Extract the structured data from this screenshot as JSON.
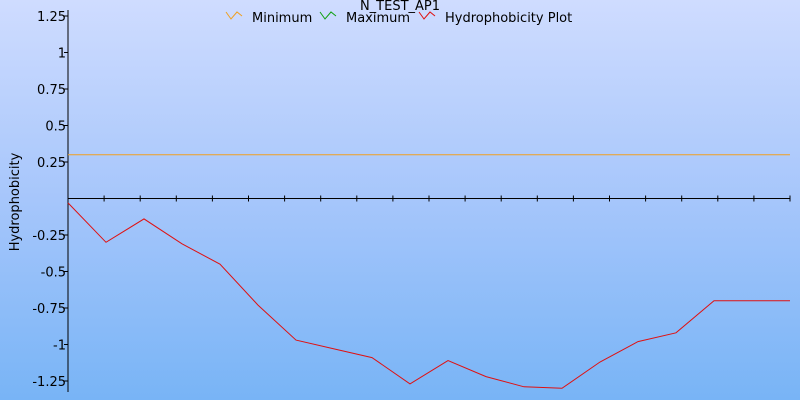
{
  "chart_data": {
    "type": "line",
    "title": "N_TEST_AP1",
    "xlabel": "",
    "ylabel": "Hydrophobicity",
    "ylim": [
      -1.3,
      1.35
    ],
    "y_ticks": [
      1.25,
      1,
      0.75,
      0.5,
      0.25,
      -0.25,
      -0.5,
      -0.75,
      -1,
      -1.25
    ],
    "y_tick_labels": [
      "1.25",
      "1",
      "0.75",
      "0.5",
      "0.25",
      "-0.25",
      "-0.5",
      "-0.75",
      "-1",
      "-1.25"
    ],
    "x": [
      1,
      2,
      3,
      4,
      5,
      6,
      7,
      8,
      9,
      10,
      11,
      12,
      13,
      14,
      15,
      16,
      17,
      18,
      19,
      20
    ],
    "xlim": [
      1,
      20
    ],
    "x_minor_ticks": 20,
    "legend_position": "top-center",
    "grid": false,
    "series": [
      {
        "name": "Minimum",
        "color": "#f0a020",
        "values": [
          0.3,
          0.3,
          0.3,
          0.3,
          0.3,
          0.3,
          0.3,
          0.3,
          0.3,
          0.3,
          0.3,
          0.3,
          0.3,
          0.3,
          0.3,
          0.3,
          0.3,
          0.3,
          0.3,
          0.3
        ]
      },
      {
        "name": "Maximum",
        "color": "#10a010",
        "values": []
      },
      {
        "name": "Hydrophobicity Plot",
        "color": "#e01010",
        "values": [
          -0.03,
          -0.3,
          -0.14,
          -0.31,
          -0.45,
          -0.73,
          -0.97,
          -1.03,
          -1.09,
          -1.27,
          -1.11,
          -1.22,
          -1.29,
          -1.3,
          -1.12,
          -0.98,
          -0.92,
          -0.7,
          -0.7,
          -0.7
        ]
      }
    ]
  }
}
